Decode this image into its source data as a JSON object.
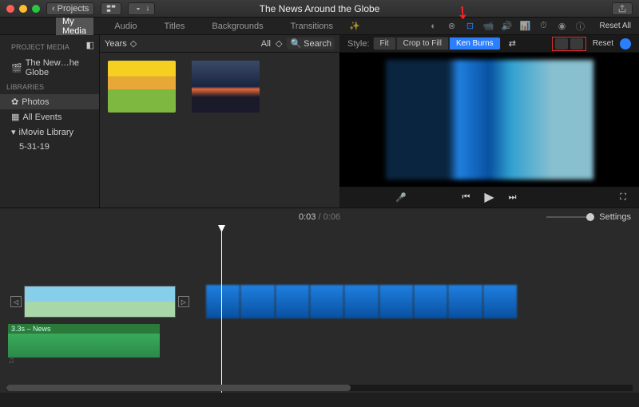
{
  "title": "The News Around the Globe",
  "titlebar": {
    "projects": "Projects"
  },
  "tabs": {
    "mymedia": "My Media",
    "audio": "Audio",
    "titles": "Titles",
    "backgrounds": "Backgrounds",
    "transitions": "Transitions"
  },
  "sidebar": {
    "projectHdr": "PROJECT MEDIA",
    "project": "The New…he Globe",
    "librariesHdr": "LIBRARIES",
    "photos": "Photos",
    "allEvents": "All Events",
    "imovieLib": "iMovie Library",
    "date": "5-31-19"
  },
  "browser": {
    "years": "Years",
    "all": "All",
    "searchPlaceholder": "Search"
  },
  "adjust": {
    "resetAll": "Reset All"
  },
  "crop": {
    "styleLabel": "Style:",
    "fit": "Fit",
    "cropToFill": "Crop to Fill",
    "kenBurns": "Ken Burns",
    "reset": "Reset"
  },
  "time": {
    "current": "0:03",
    "total": "0:06",
    "settings": "Settings"
  },
  "audioClip": {
    "label": "3.3s – News"
  }
}
